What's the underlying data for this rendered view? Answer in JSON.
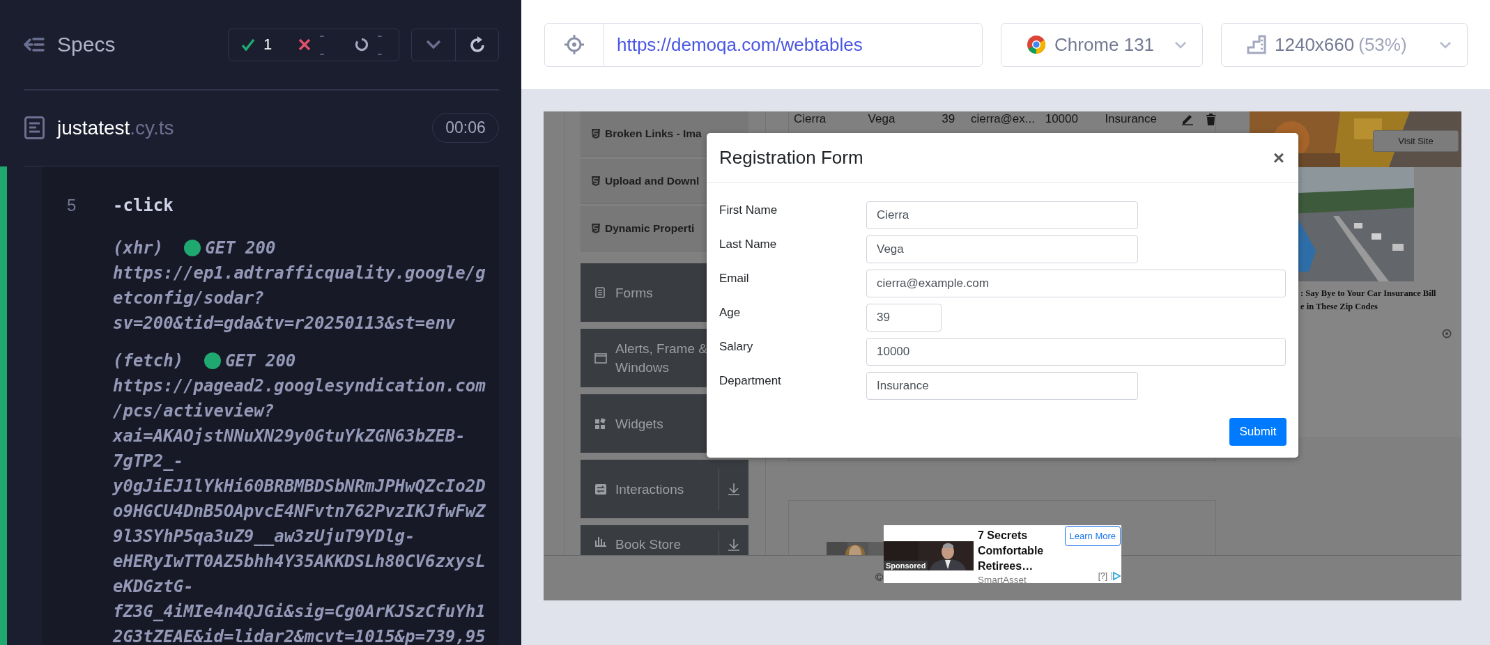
{
  "reporter": {
    "back_label": "Specs",
    "stats": {
      "passed": "1",
      "failed": "--",
      "pending": "--"
    },
    "spec": {
      "name": "justatest",
      "extension": ".cy.ts",
      "duration": "00:06"
    },
    "log": [
      {
        "kind": "command",
        "number": "5",
        "name": "-click"
      },
      {
        "kind": "request",
        "method": "(xhr)",
        "status": "GET 200",
        "url": "https://ep1.adtrafficquality.google/getconfig/sodar?sv=200&tid=gda&tv=r20250113&st=env"
      },
      {
        "kind": "request",
        "method": "(fetch)",
        "status": "GET 200",
        "url": "https://pagead2.googlesyndication.com/pcs/activeview?xai=AKAOjstNNuXN29y0GtuYkZGN63bZEB-7gTP2_-y0gJiEJ1lYkHi60BRBMBDSbNRmJPHwQZcIo2Do9HGCU4DnB5OApvcE4NFvtn762PvzIKJfwFwZ9l3SYhP5qa3uZ9__aw3zUjuT9YDlg-eHERyIwTT0AZ5bhh4Y35AKKDSLh80CV6zxysLeKDGztG-fZ3G_4iMIe4n4QJGi&sig=Cg0ArKJSzCfuYh12G3tZEAE&id=lidar2&mcvt=1015&p=739,95"
      }
    ]
  },
  "toolbar": {
    "url": "https://demoqa.com/webtables",
    "browser": "Chrome 131",
    "viewport": "1240x660",
    "scale": "(53%)"
  },
  "app": {
    "sidebar": [
      {
        "kind": "element",
        "label": "Broken Links - Ima"
      },
      {
        "kind": "element",
        "label": "Upload and Downl"
      },
      {
        "kind": "element",
        "label": "Dynamic Properti"
      },
      {
        "kind": "group",
        "label": "Forms"
      },
      {
        "kind": "group",
        "label": "Alerts, Frame & Windows"
      },
      {
        "kind": "group",
        "label": "Widgets"
      },
      {
        "kind": "group",
        "label": "Interactions",
        "collapsible": true
      },
      {
        "kind": "group",
        "label": "Book Store",
        "collapsible": true
      }
    ],
    "table_row": [
      "Cierra",
      "Vega",
      "39",
      "cierra@ex...",
      "10000",
      "Insurance"
    ],
    "side_ad": {
      "button": "Visit Site",
      "caption": [
        ": Say Bye to Your Car Insurance Bill",
        "e in These Zip Codes"
      ]
    },
    "footer": "©",
    "modal": {
      "title": "Registration Form",
      "close": "×",
      "fields": [
        {
          "label": "First Name",
          "value": "Cierra",
          "kind": "short"
        },
        {
          "label": "Last Name",
          "value": "Vega",
          "kind": "short"
        },
        {
          "label": "Email",
          "value": "cierra@example.com",
          "kind": "long"
        },
        {
          "label": "Age",
          "value": "39",
          "kind": "tiny"
        },
        {
          "label": "Salary",
          "value": "10000",
          "kind": "long"
        },
        {
          "label": "Department",
          "value": "Insurance",
          "kind": "short"
        }
      ],
      "submit": "Submit"
    },
    "bottom_ad": {
      "label": "Sponsored",
      "headline": "7 Secrets Comfortable Retirees…",
      "advertiser": "SmartAsset",
      "button": "Learn More",
      "info": "[?]"
    }
  }
}
